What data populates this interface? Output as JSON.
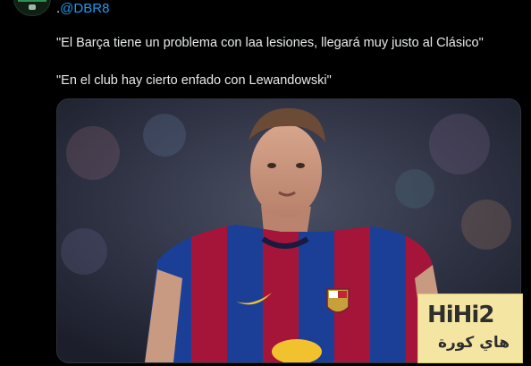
{
  "tweet": {
    "mention_prefix": ".",
    "mention_handle": "@DBR8",
    "quote_1": "\"El Barça tiene un problema con laa lesiones, llegará muy justo al Clásico\"",
    "quote_2": "\"En el club hay cierto enfado con Lewandowski\""
  },
  "watermark": {
    "latin": "HiHi2",
    "arabic": "هاي كورة"
  },
  "colors": {
    "background": "#000000",
    "text": "#e7e9ea",
    "link": "#1d9bf0",
    "kit_blue": "#1b3f96",
    "kit_red": "#a5153a"
  },
  "icons": {
    "avatar": "account-avatar",
    "crest": "club-crest-icon",
    "swoosh": "brand-swoosh-icon"
  }
}
